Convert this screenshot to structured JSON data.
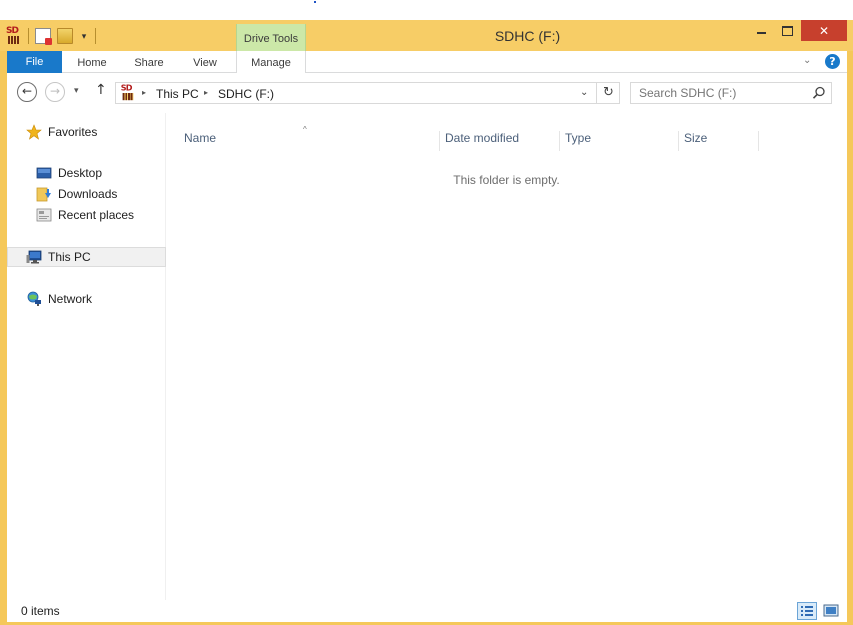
{
  "window": {
    "title": "SDHC (F:)",
    "close_glyph": "✕"
  },
  "ribbon": {
    "context_group": "Drive Tools",
    "tabs": [
      {
        "label": "File",
        "active": true
      },
      {
        "label": "Home"
      },
      {
        "label": "Share"
      },
      {
        "label": "View"
      },
      {
        "label": "Manage"
      }
    ],
    "expand_glyph": "⌄",
    "help_glyph": "?"
  },
  "navigation": {
    "back_glyph": "←",
    "forward_glyph": "→",
    "recent_glyph": "▾",
    "up_glyph": "↑"
  },
  "address": {
    "breadcrumbs": [
      "This PC",
      "SDHC (F:)"
    ],
    "separator_glyph": "▸",
    "dropdown_glyph": "⌄",
    "refresh_glyph": "↻"
  },
  "search": {
    "placeholder": "Search SDHC (F:)"
  },
  "nav_pane": {
    "favorites_label": "Favorites",
    "favorites": [
      "Desktop",
      "Downloads",
      "Recent places"
    ],
    "this_pc_label": "This PC",
    "network_label": "Network"
  },
  "columns": [
    {
      "label": "Name"
    },
    {
      "label": "Date modified"
    },
    {
      "label": "Type"
    },
    {
      "label": "Size"
    }
  ],
  "sort_caret": "^",
  "content": {
    "empty_message": "This folder is empty."
  },
  "status": {
    "item_count": "0 items"
  },
  "colors": {
    "title_bar": "#f7cd66",
    "file_tab": "#1979ca",
    "context_tab": "#cce8a8",
    "close_button": "#c7402d"
  }
}
